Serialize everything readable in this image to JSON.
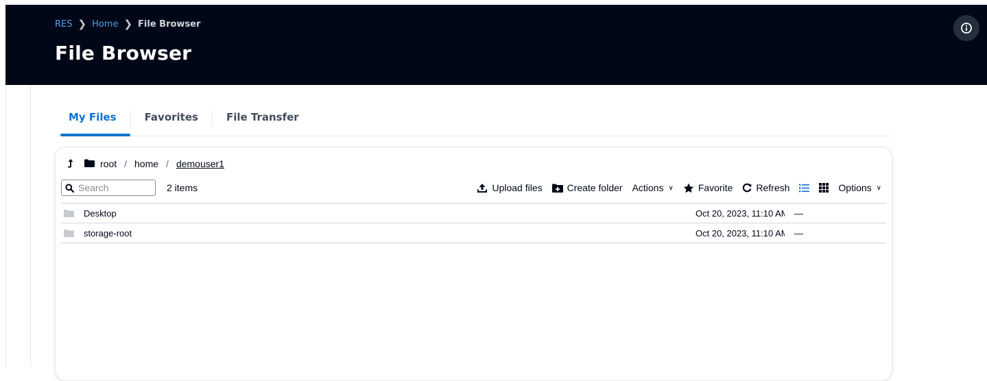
{
  "header": {
    "breadcrumb": [
      {
        "label": "RES"
      },
      {
        "label": "Home"
      },
      {
        "label": "File Browser"
      }
    ],
    "title": "File Browser",
    "info_icon": "info-circle-icon"
  },
  "tabs": [
    {
      "label": "My Files",
      "active": true
    },
    {
      "label": "Favorites",
      "active": false
    },
    {
      "label": "File Transfer",
      "active": false
    }
  ],
  "path": {
    "segments": [
      "root",
      "home",
      "demouser1"
    ],
    "separator": "/"
  },
  "toolbar": {
    "search_placeholder": "Search",
    "search_value": "",
    "items_count": "2 items",
    "upload_label": "Upload files",
    "create_folder_label": "Create folder",
    "actions_label": "Actions",
    "favorite_label": "Favorite",
    "refresh_label": "Refresh",
    "options_label": "Options",
    "accent_color": "#0972d3"
  },
  "files": [
    {
      "name": "Desktop",
      "modified": "Oct 20, 2023, 11:10 AM",
      "size": "—",
      "icon": "folder-icon"
    },
    {
      "name": "storage-root",
      "modified": "Oct 20, 2023, 11:10 AM",
      "size": "—",
      "icon": "folder-icon"
    }
  ]
}
